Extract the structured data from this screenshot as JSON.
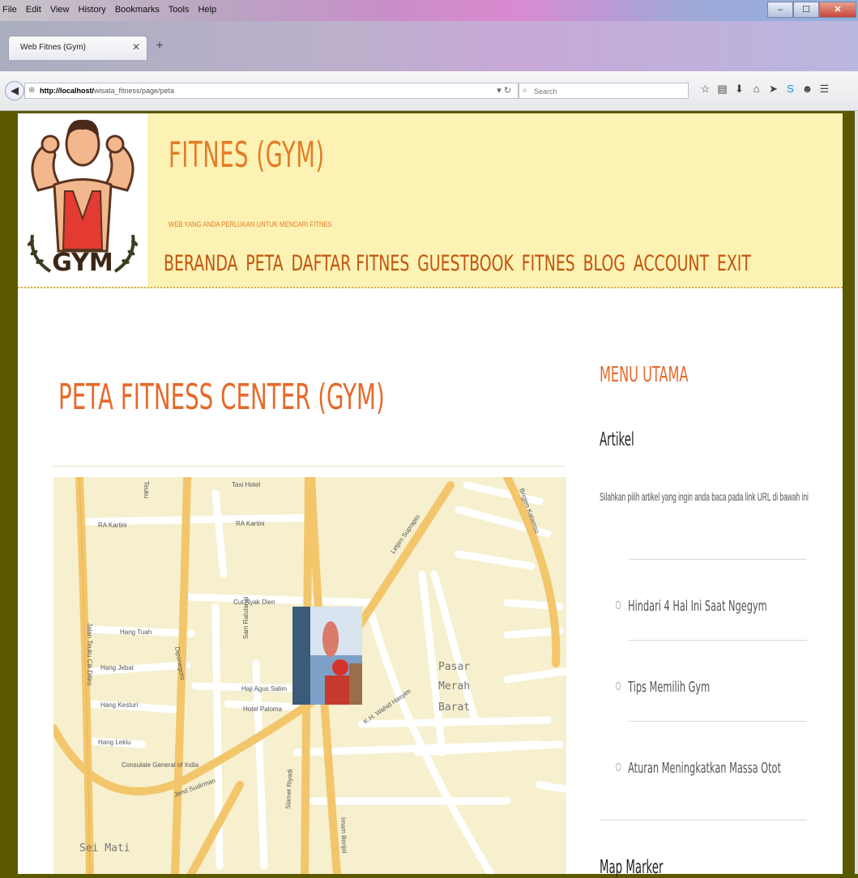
{
  "browser": {
    "menu": [
      "File",
      "Edit",
      "View",
      "History",
      "Bookmarks",
      "Tools",
      "Help"
    ],
    "tab_title": "Web Fitnes (Gym)",
    "url_host": "http://localhost/",
    "url_path": "wisata_fitness/page/peta",
    "search_placeholder": "Search"
  },
  "site": {
    "title": "FITNES (GYM)",
    "tagline": "WEB YANG ANDA PERLUKAN UNTUK MENCARI FITNES",
    "logo_text": "GYM",
    "nav": [
      "BERANDA",
      "PETA",
      "DAFTAR FITNES",
      "GUESTBOOK",
      "FITNES",
      "BLOG",
      "ACCOUNT",
      "EXIT"
    ]
  },
  "main": {
    "title": "PETA FITNESS CENTER (GYM)",
    "map_labels": {
      "taxi_hotel": "Taxi Hotel",
      "ra_kartini_1": "RA Kartini",
      "ra_kartini_2": "RA Kartini",
      "cut_nyak_dien": "Cut Nyak Dien",
      "hang_tuah": "Hang Tuah",
      "hang_jebat": "Hang Jebat",
      "hang_kesturi": "Hang Kesturi",
      "hang_lekiu": "Hang Lekiu",
      "haji_agus_salim": "Haji Agus Salim",
      "hotel_paloma": "Hotel Paloma",
      "consulate": "Consulate General of India",
      "jend_sudirman": "Jend Sudirman",
      "sei_mati": "Sei Mati",
      "pasar": "Pasar",
      "merah": "Merah",
      "barat": "Barat",
      "jalan_teuku_cikditiro": "Jalan Teuku Cik Ditiro",
      "diponegoro": "Diponegoro",
      "sam_ratulangi": "Sam Ratulangi",
      "slamet_riyadi": "Slamet Riyadi",
      "imam_bonjol": "Imam Bonjol",
      "letjen_suprapto": "Letjen Suprapto",
      "brigjen_katamso": "Brigjen Katamso",
      "kh_wahid_hasyim": "K.H. Wahid Hasyim",
      "teuku": "Teuku"
    }
  },
  "sidebar": {
    "title": "MENU UTAMA",
    "artikel_heading": "Artikel",
    "artikel_desc": "Silahkan pilih artikel yang ingin anda baca pada link URL di bawah ini",
    "links": [
      "Hindari 4 Hal Ini Saat Ngegym",
      "Tips Memilih Gym",
      "Aturan Meningkatkan Massa Otot"
    ],
    "map_marker_heading": "Map Marker"
  },
  "colors": {
    "header_bg": "#fcf2b3",
    "accent": "#e56a2a",
    "nav": "#c2540e",
    "frame": "#5b5900"
  }
}
